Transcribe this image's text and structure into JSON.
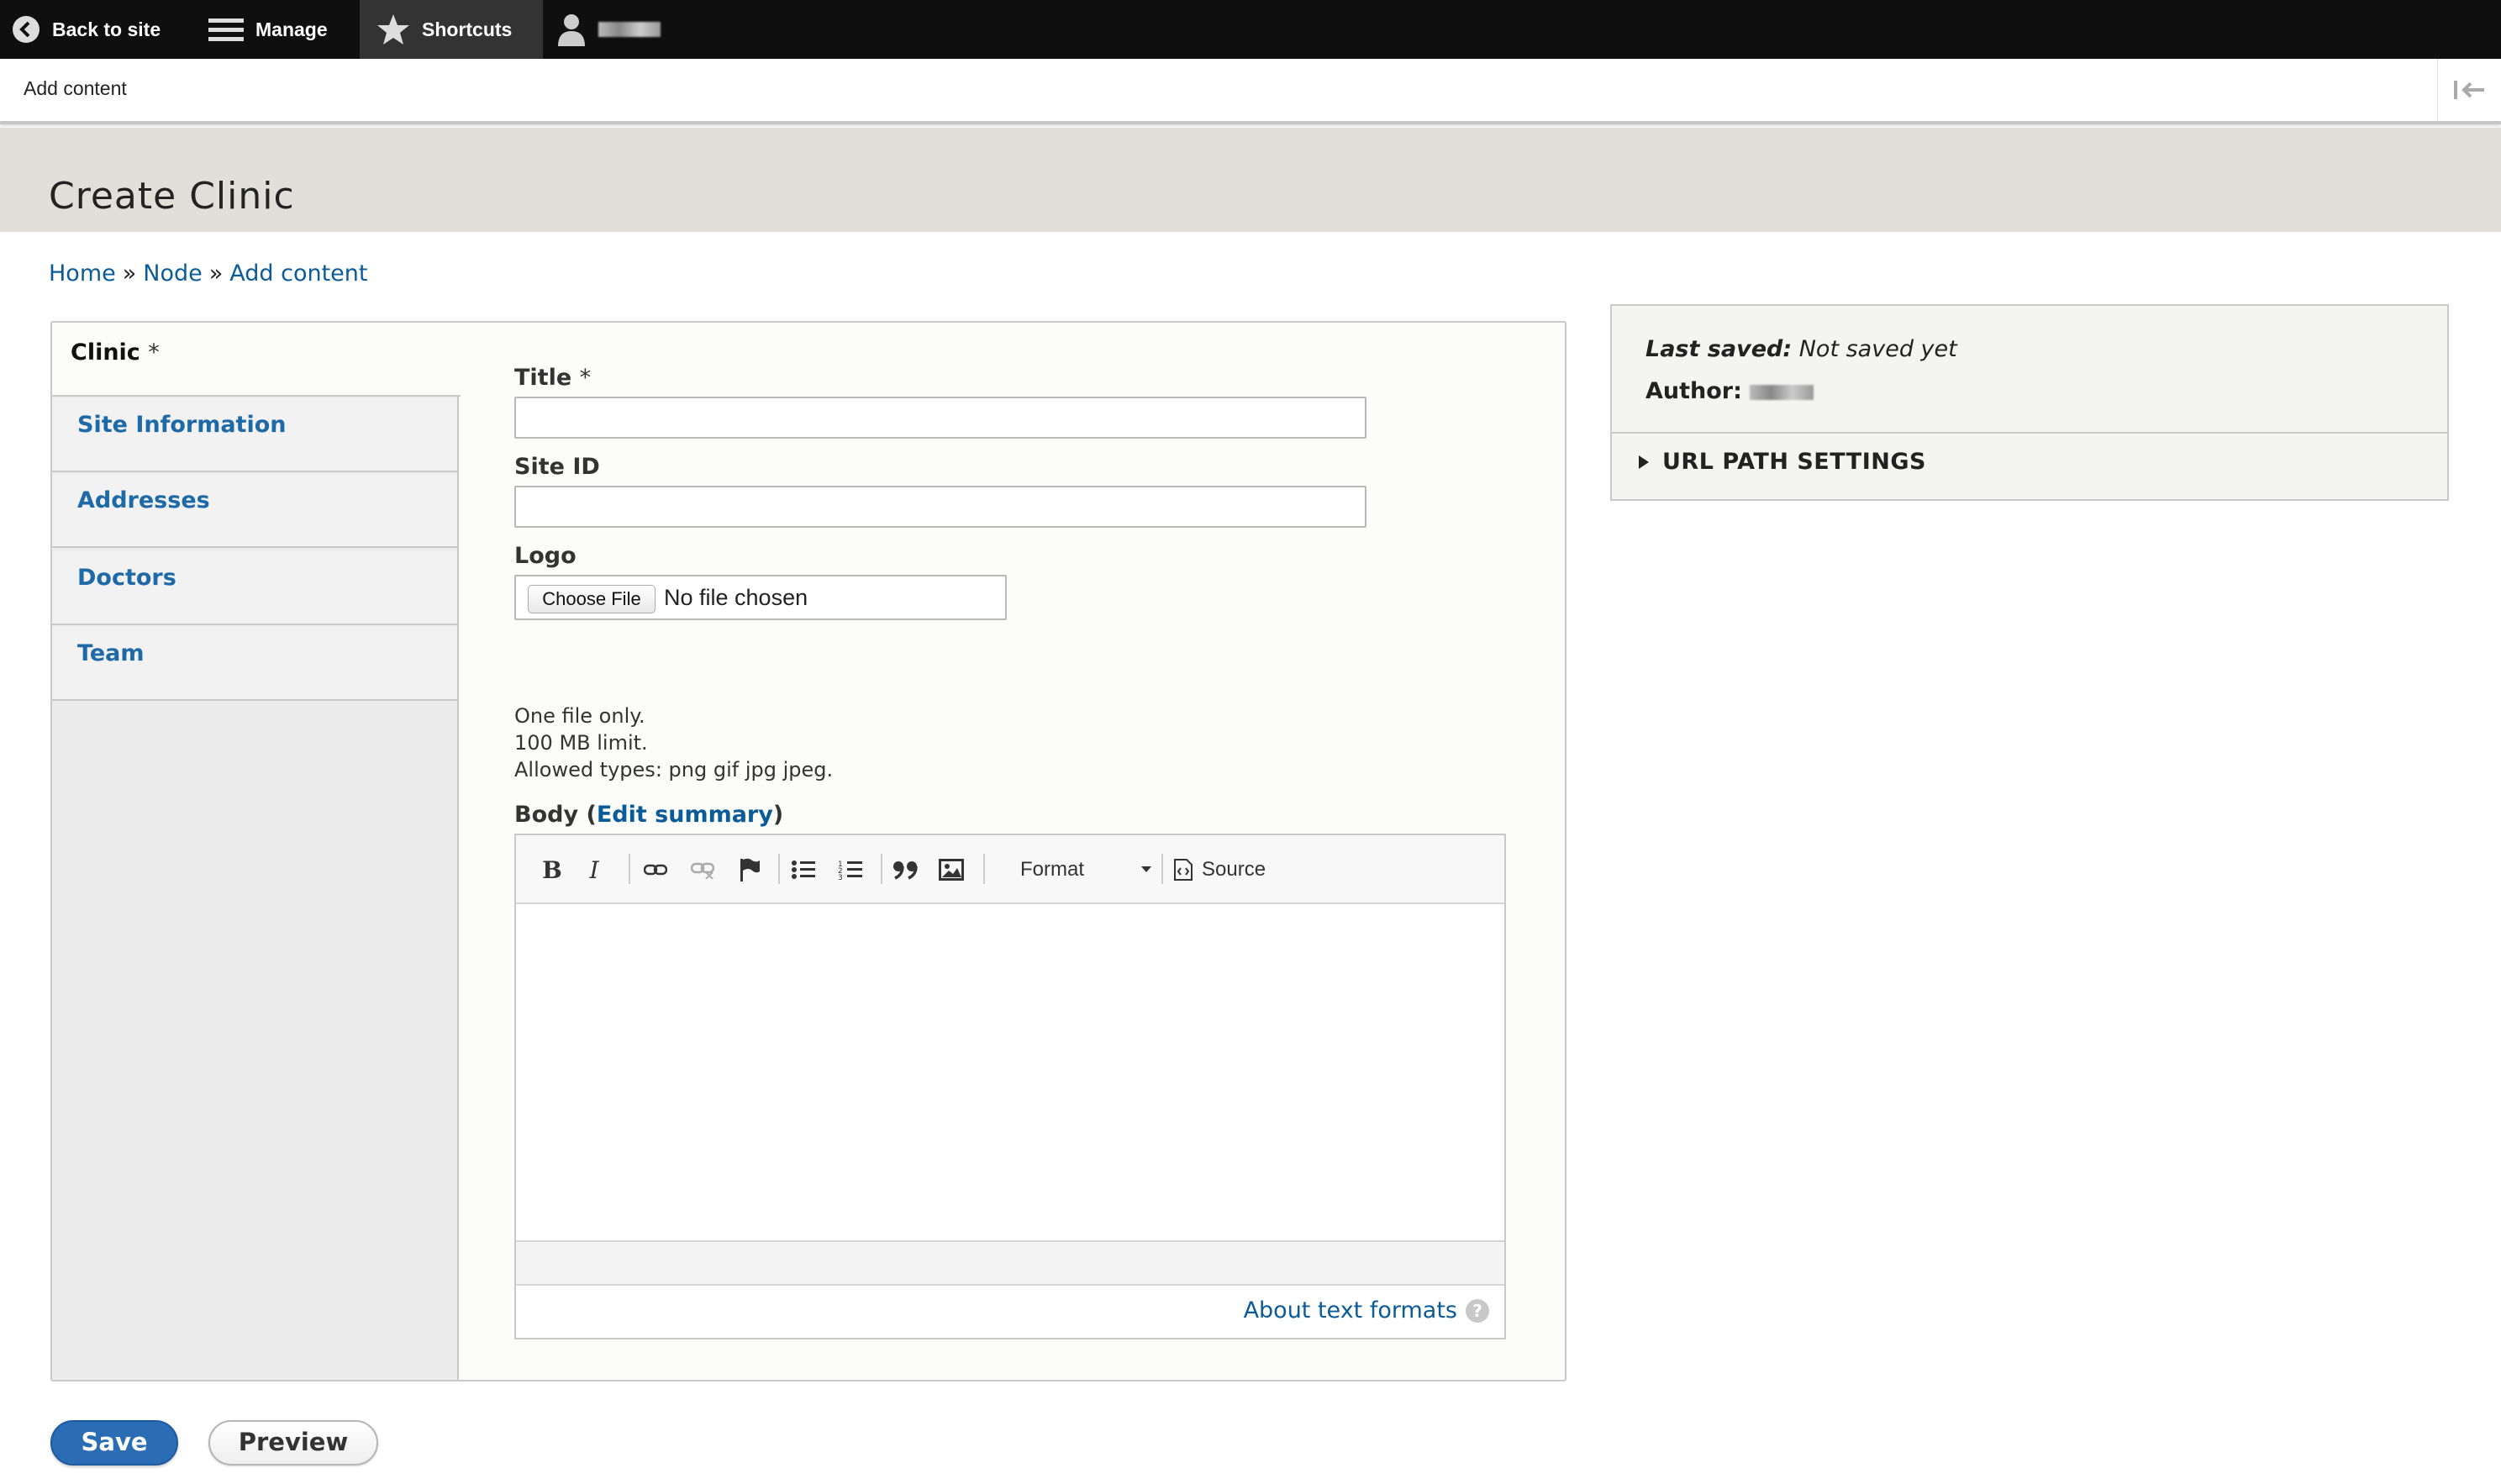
{
  "toolbar": {
    "back_label": "Back to site",
    "manage_label": "Manage",
    "shortcuts_label": "Shortcuts"
  },
  "tray": {
    "add_content_label": "Add content"
  },
  "page": {
    "title": "Create Clinic"
  },
  "breadcrumb": {
    "items": [
      "Home",
      "Node",
      "Add content"
    ],
    "separator": "»"
  },
  "tabs": [
    {
      "label": "Clinic",
      "required_mark": "*"
    },
    {
      "label": "Site Information"
    },
    {
      "label": "Addresses"
    },
    {
      "label": "Doctors"
    },
    {
      "label": "Team"
    }
  ],
  "form": {
    "title_label": "Title",
    "required_mark": "*",
    "title_value": "",
    "siteid_label": "Site ID",
    "siteid_value": "",
    "logo_label": "Logo",
    "choose_file_label": "Choose File",
    "file_status": "No file chosen",
    "help_lines": [
      "One file only.",
      "100 MB limit.",
      "Allowed types: png gif jpg jpeg."
    ],
    "body_label": "Body",
    "edit_summary_label": "Edit summary",
    "format_label": "Format",
    "source_label": "Source",
    "about_text_formats": "About text formats",
    "help_icon_glyph": "?"
  },
  "sidebar": {
    "last_saved_label": "Last saved:",
    "last_saved_value": "Not saved yet",
    "author_label": "Author:",
    "url_path_label": "URL PATH SETTINGS"
  },
  "actions": {
    "save_label": "Save",
    "preview_label": "Preview"
  }
}
